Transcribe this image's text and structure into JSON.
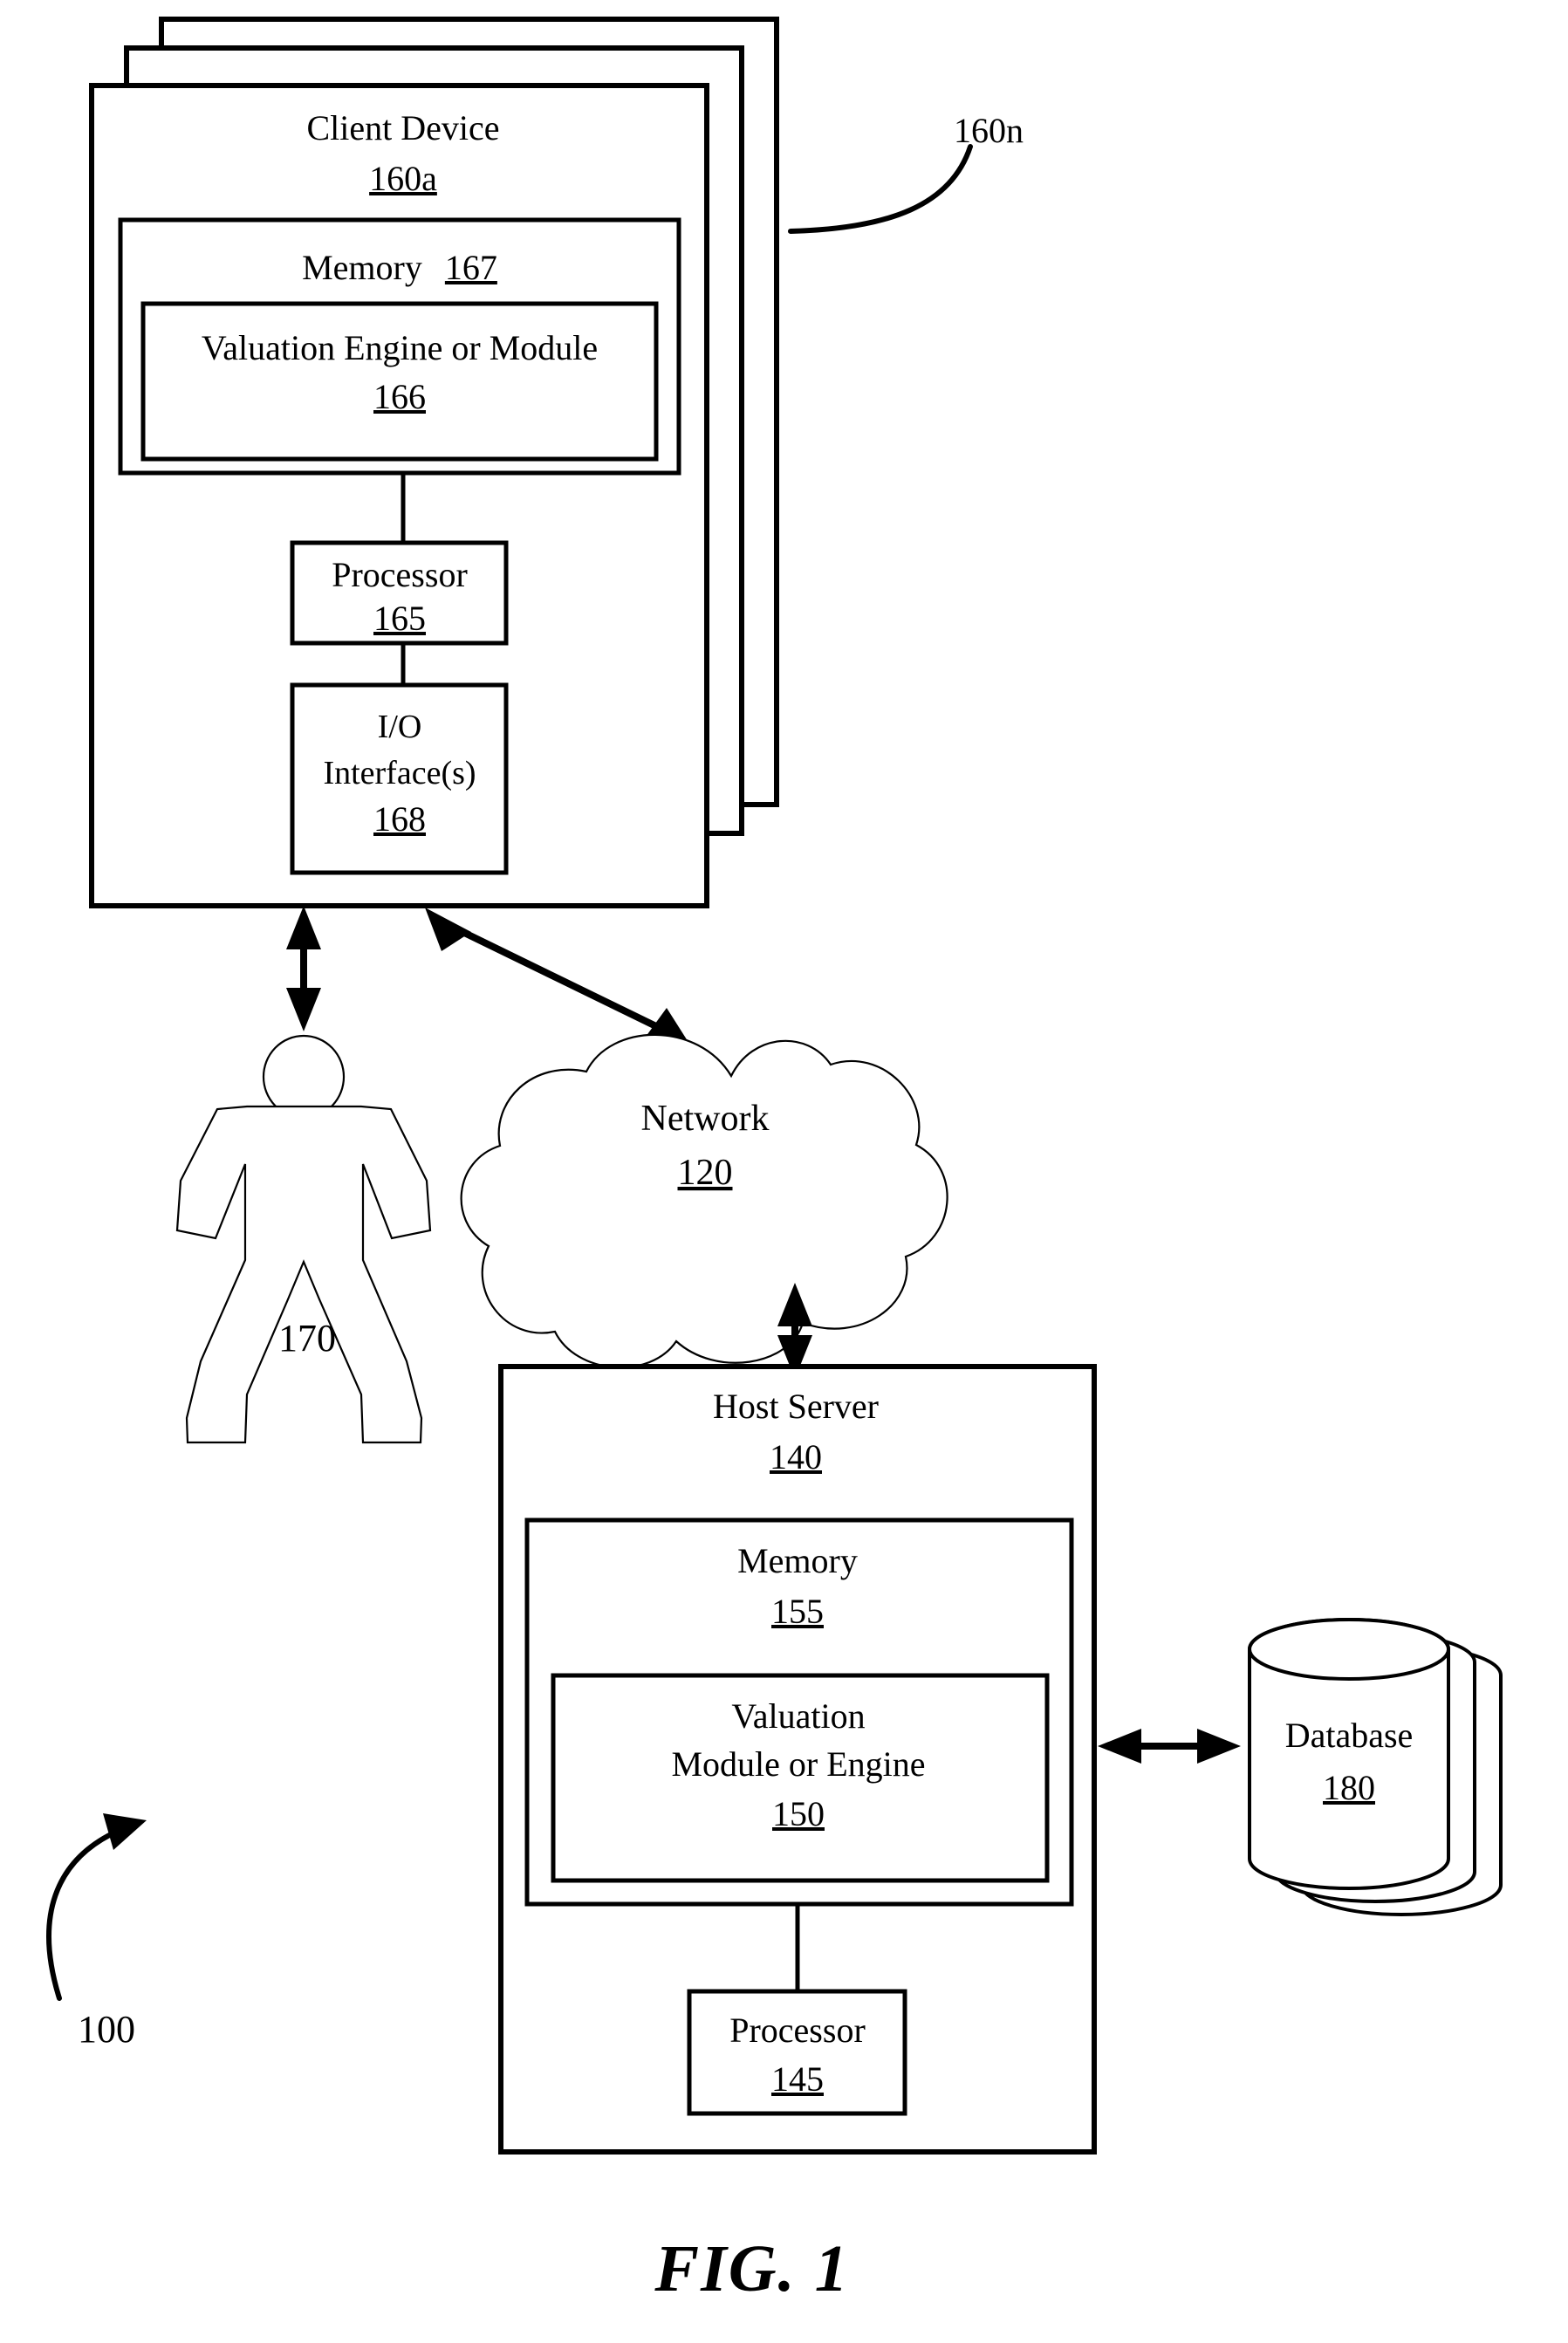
{
  "figure": {
    "caption": "FIG. 1",
    "system_ref": "100"
  },
  "client_stack": {
    "callout_label": "160n",
    "device": {
      "title": "Client Device",
      "ref": "160a"
    },
    "memory": {
      "title": "Memory",
      "ref": "167"
    },
    "valuation": {
      "title": "Valuation Engine or Module",
      "ref": "166"
    },
    "processor": {
      "title": "Processor",
      "ref": "165"
    },
    "io": {
      "title_line1": "I/O",
      "title_line2": "Interface(s)",
      "ref": "168"
    }
  },
  "user": {
    "ref": "170",
    "icon": "person-icon"
  },
  "network": {
    "title": "Network",
    "ref": "120",
    "icon": "cloud-icon"
  },
  "host_server": {
    "title": "Host Server",
    "ref": "140",
    "memory": {
      "title": "Memory",
      "ref": "155"
    },
    "valuation": {
      "title_line1": "Valuation",
      "title_line2": "Module or Engine",
      "ref": "150"
    },
    "processor": {
      "title": "Processor",
      "ref": "145"
    }
  },
  "database": {
    "title": "Database",
    "ref": "180",
    "icon": "database-cylinder-icon"
  },
  "connections": {
    "user_to_client": "bidirectional",
    "client_to_network": "bidirectional",
    "network_to_host": "bidirectional",
    "host_to_database": "bidirectional"
  },
  "colors": {
    "ink": "#000000",
    "paper": "#ffffff"
  }
}
